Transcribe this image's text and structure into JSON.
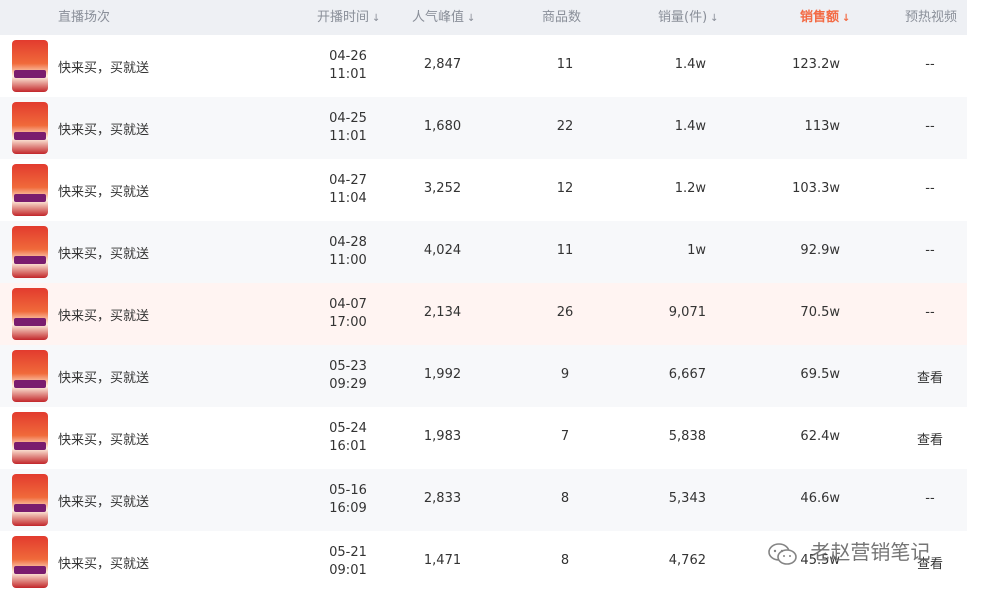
{
  "header": {
    "session": "直播场次",
    "start_time": "开播时间",
    "peak_popularity": "人气峰值",
    "goods_count": "商品数",
    "sales_volume": "销量(件)",
    "sales_amount": "销售额",
    "preheat_video": "预热视频",
    "sort_arrow": "↓",
    "active_color": "#f36b45"
  },
  "rows": [
    {
      "title": "快来买，买就送",
      "date": "04-26",
      "time": "11:01",
      "popularity": "2,847",
      "goods": "11",
      "volume": "1.4w",
      "amount": "123.2w",
      "video": "--"
    },
    {
      "title": "快来买，买就送",
      "date": "04-25",
      "time": "11:01",
      "popularity": "1,680",
      "goods": "22",
      "volume": "1.4w",
      "amount": "113w",
      "video": "--"
    },
    {
      "title": "快来买，买就送",
      "date": "04-27",
      "time": "11:04",
      "popularity": "3,252",
      "goods": "12",
      "volume": "1.2w",
      "amount": "103.3w",
      "video": "--"
    },
    {
      "title": "快来买，买就送",
      "date": "04-28",
      "time": "11:00",
      "popularity": "4,024",
      "goods": "11",
      "volume": "1w",
      "amount": "92.9w",
      "video": "--"
    },
    {
      "title": "快来买，买就送",
      "date": "04-07",
      "time": "17:00",
      "popularity": "2,134",
      "goods": "26",
      "volume": "9,071",
      "amount": "70.5w",
      "video": "--"
    },
    {
      "title": "快来买，买就送",
      "date": "05-23",
      "time": "09:29",
      "popularity": "1,992",
      "goods": "9",
      "volume": "6,667",
      "amount": "69.5w",
      "video": "查看"
    },
    {
      "title": "快来买，买就送",
      "date": "05-24",
      "time": "16:01",
      "popularity": "1,983",
      "goods": "7",
      "volume": "5,838",
      "amount": "62.4w",
      "video": "查看"
    },
    {
      "title": "快来买，买就送",
      "date": "05-16",
      "time": "16:09",
      "popularity": "2,833",
      "goods": "8",
      "volume": "5,343",
      "amount": "46.6w",
      "video": "--"
    },
    {
      "title": "快来买，买就送",
      "date": "05-21",
      "time": "09:01",
      "popularity": "1,471",
      "goods": "8",
      "volume": "4,762",
      "amount": "45.5w",
      "video": "查看"
    }
  ],
  "watermark": {
    "text": "老赵营销笔记",
    "icon": "wechat-icon"
  }
}
